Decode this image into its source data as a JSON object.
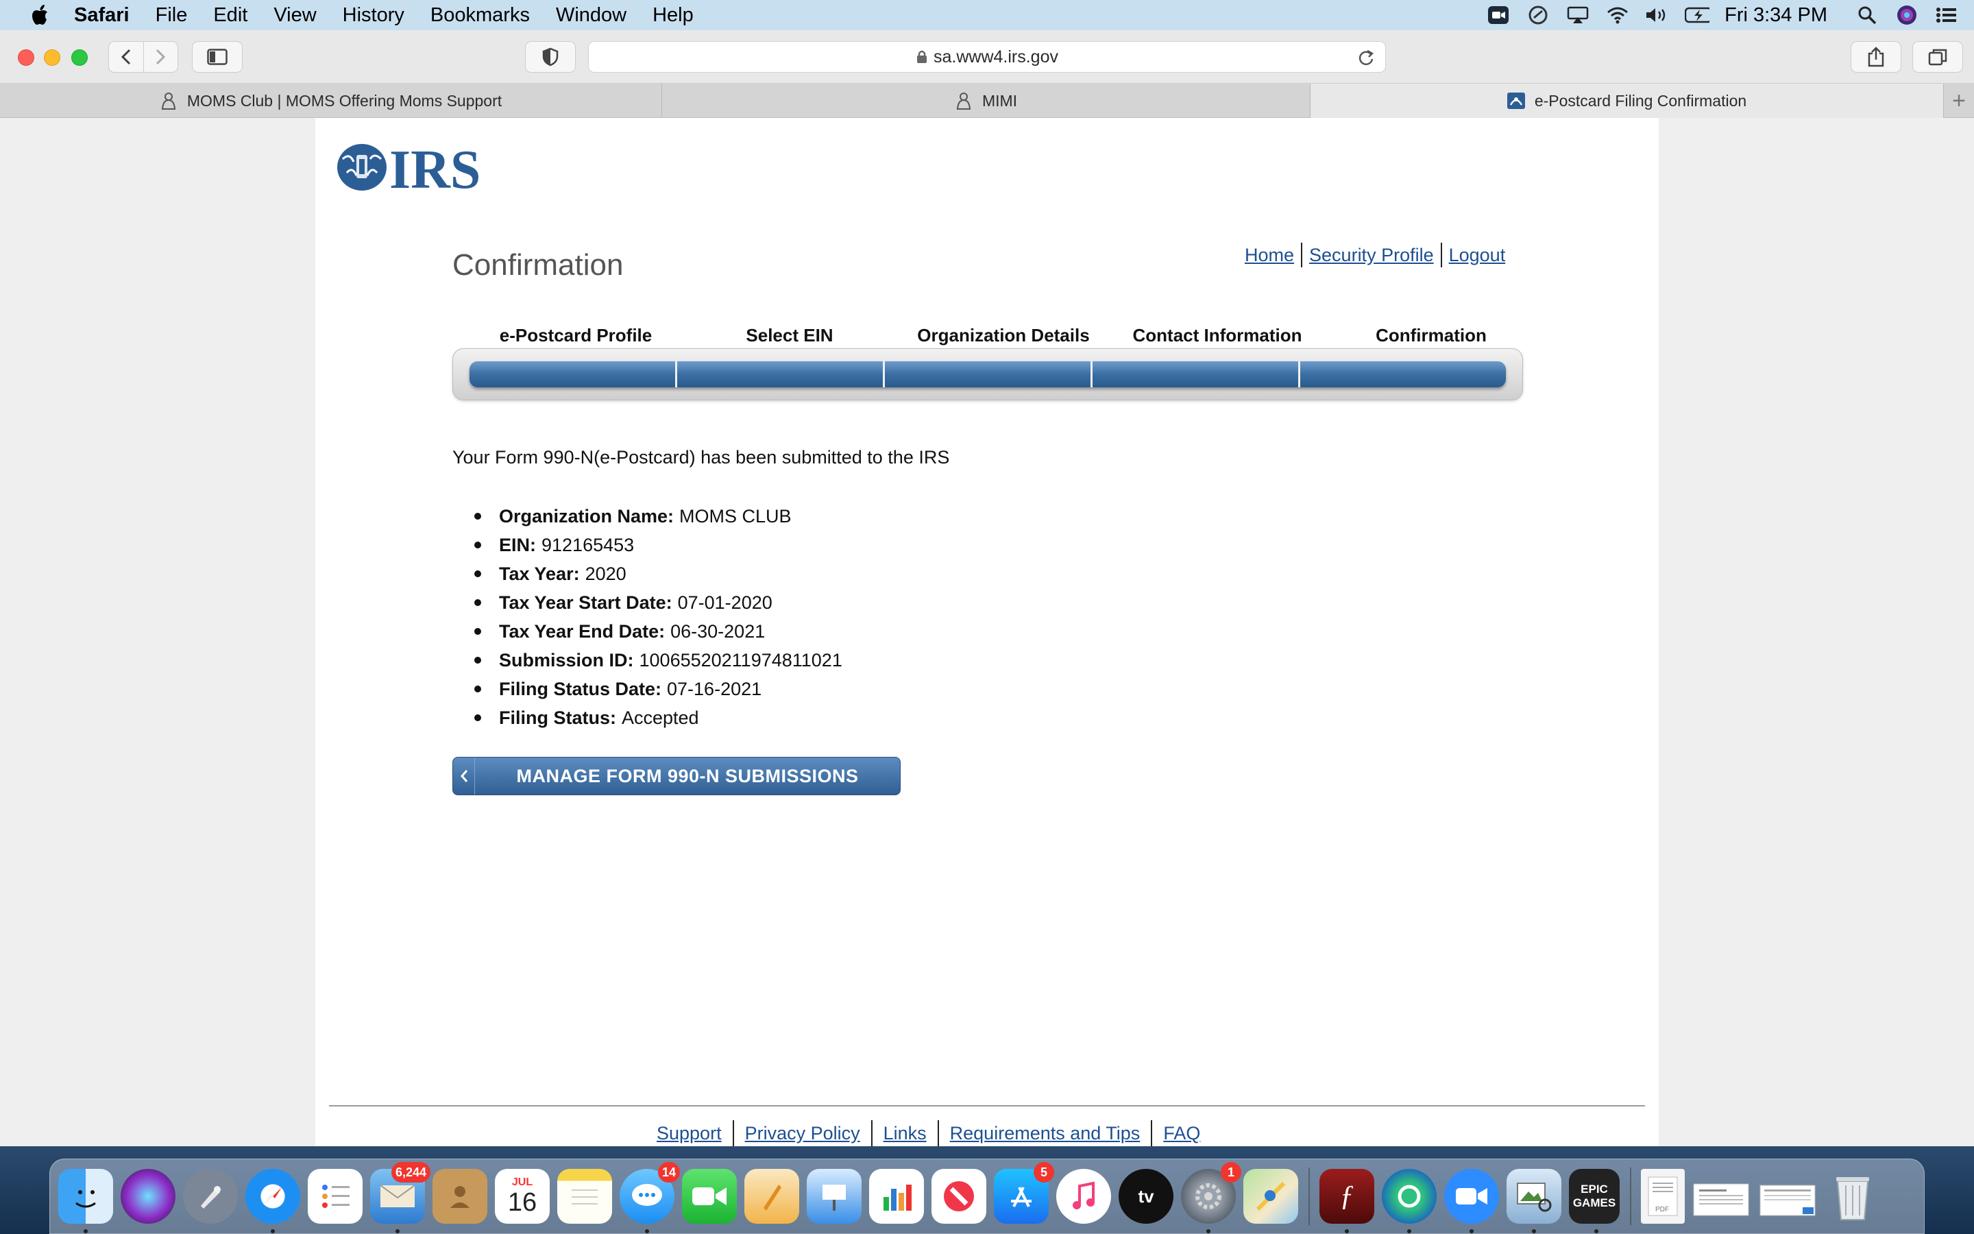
{
  "menubar": {
    "app_name": "Safari",
    "items": [
      "File",
      "Edit",
      "View",
      "History",
      "Bookmarks",
      "Window",
      "Help"
    ],
    "clock": "Fri 3:34 PM"
  },
  "browser": {
    "url": "sa.www4.irs.gov",
    "tabs": [
      {
        "title": "MOMS Club | MOMS Offering Moms Support"
      },
      {
        "title": "MIMI"
      },
      {
        "title": "e-Postcard Filing Confirmation"
      }
    ],
    "new_tab_glyph": "+"
  },
  "page": {
    "logo_text": "IRS",
    "title": "Confirmation",
    "top_links": [
      "Home",
      "Security Profile",
      "Logout"
    ],
    "steps": [
      "e-Postcard Profile",
      "Select EIN",
      "Organization Details",
      "Contact Information",
      "Confirmation"
    ],
    "message": "Your Form 990-N(e-Postcard) has been submitted to the IRS",
    "details": [
      {
        "label": "Organization Name:",
        "value": "MOMS CLUB"
      },
      {
        "label": "EIN:",
        "value": "912165453"
      },
      {
        "label": "Tax Year:",
        "value": "2020"
      },
      {
        "label": "Tax Year Start Date:",
        "value": "07-01-2020"
      },
      {
        "label": "Tax Year End Date:",
        "value": "06-30-2021"
      },
      {
        "label": "Submission ID:",
        "value": "10065520211974811021"
      },
      {
        "label": "Filing Status Date:",
        "value": "07-16-2021"
      },
      {
        "label": "Filing Status:",
        "value": "Accepted"
      }
    ],
    "manage_button": "MANAGE FORM 990-N SUBMISSIONS",
    "footer_links": [
      "Support",
      "Privacy Policy",
      "Links",
      "Requirements and Tips",
      "FAQ"
    ]
  },
  "dock": {
    "badges": {
      "mail": "6,244",
      "messages": "14",
      "app_store": "5",
      "system_prefs": "1"
    },
    "calendar": {
      "month": "JUL",
      "day": "16"
    },
    "epic_label": "EPIC GAMES"
  },
  "colors": {
    "link": "#1d4f91",
    "irs_blue": "#2c5e96",
    "badge": "#f0352f"
  }
}
